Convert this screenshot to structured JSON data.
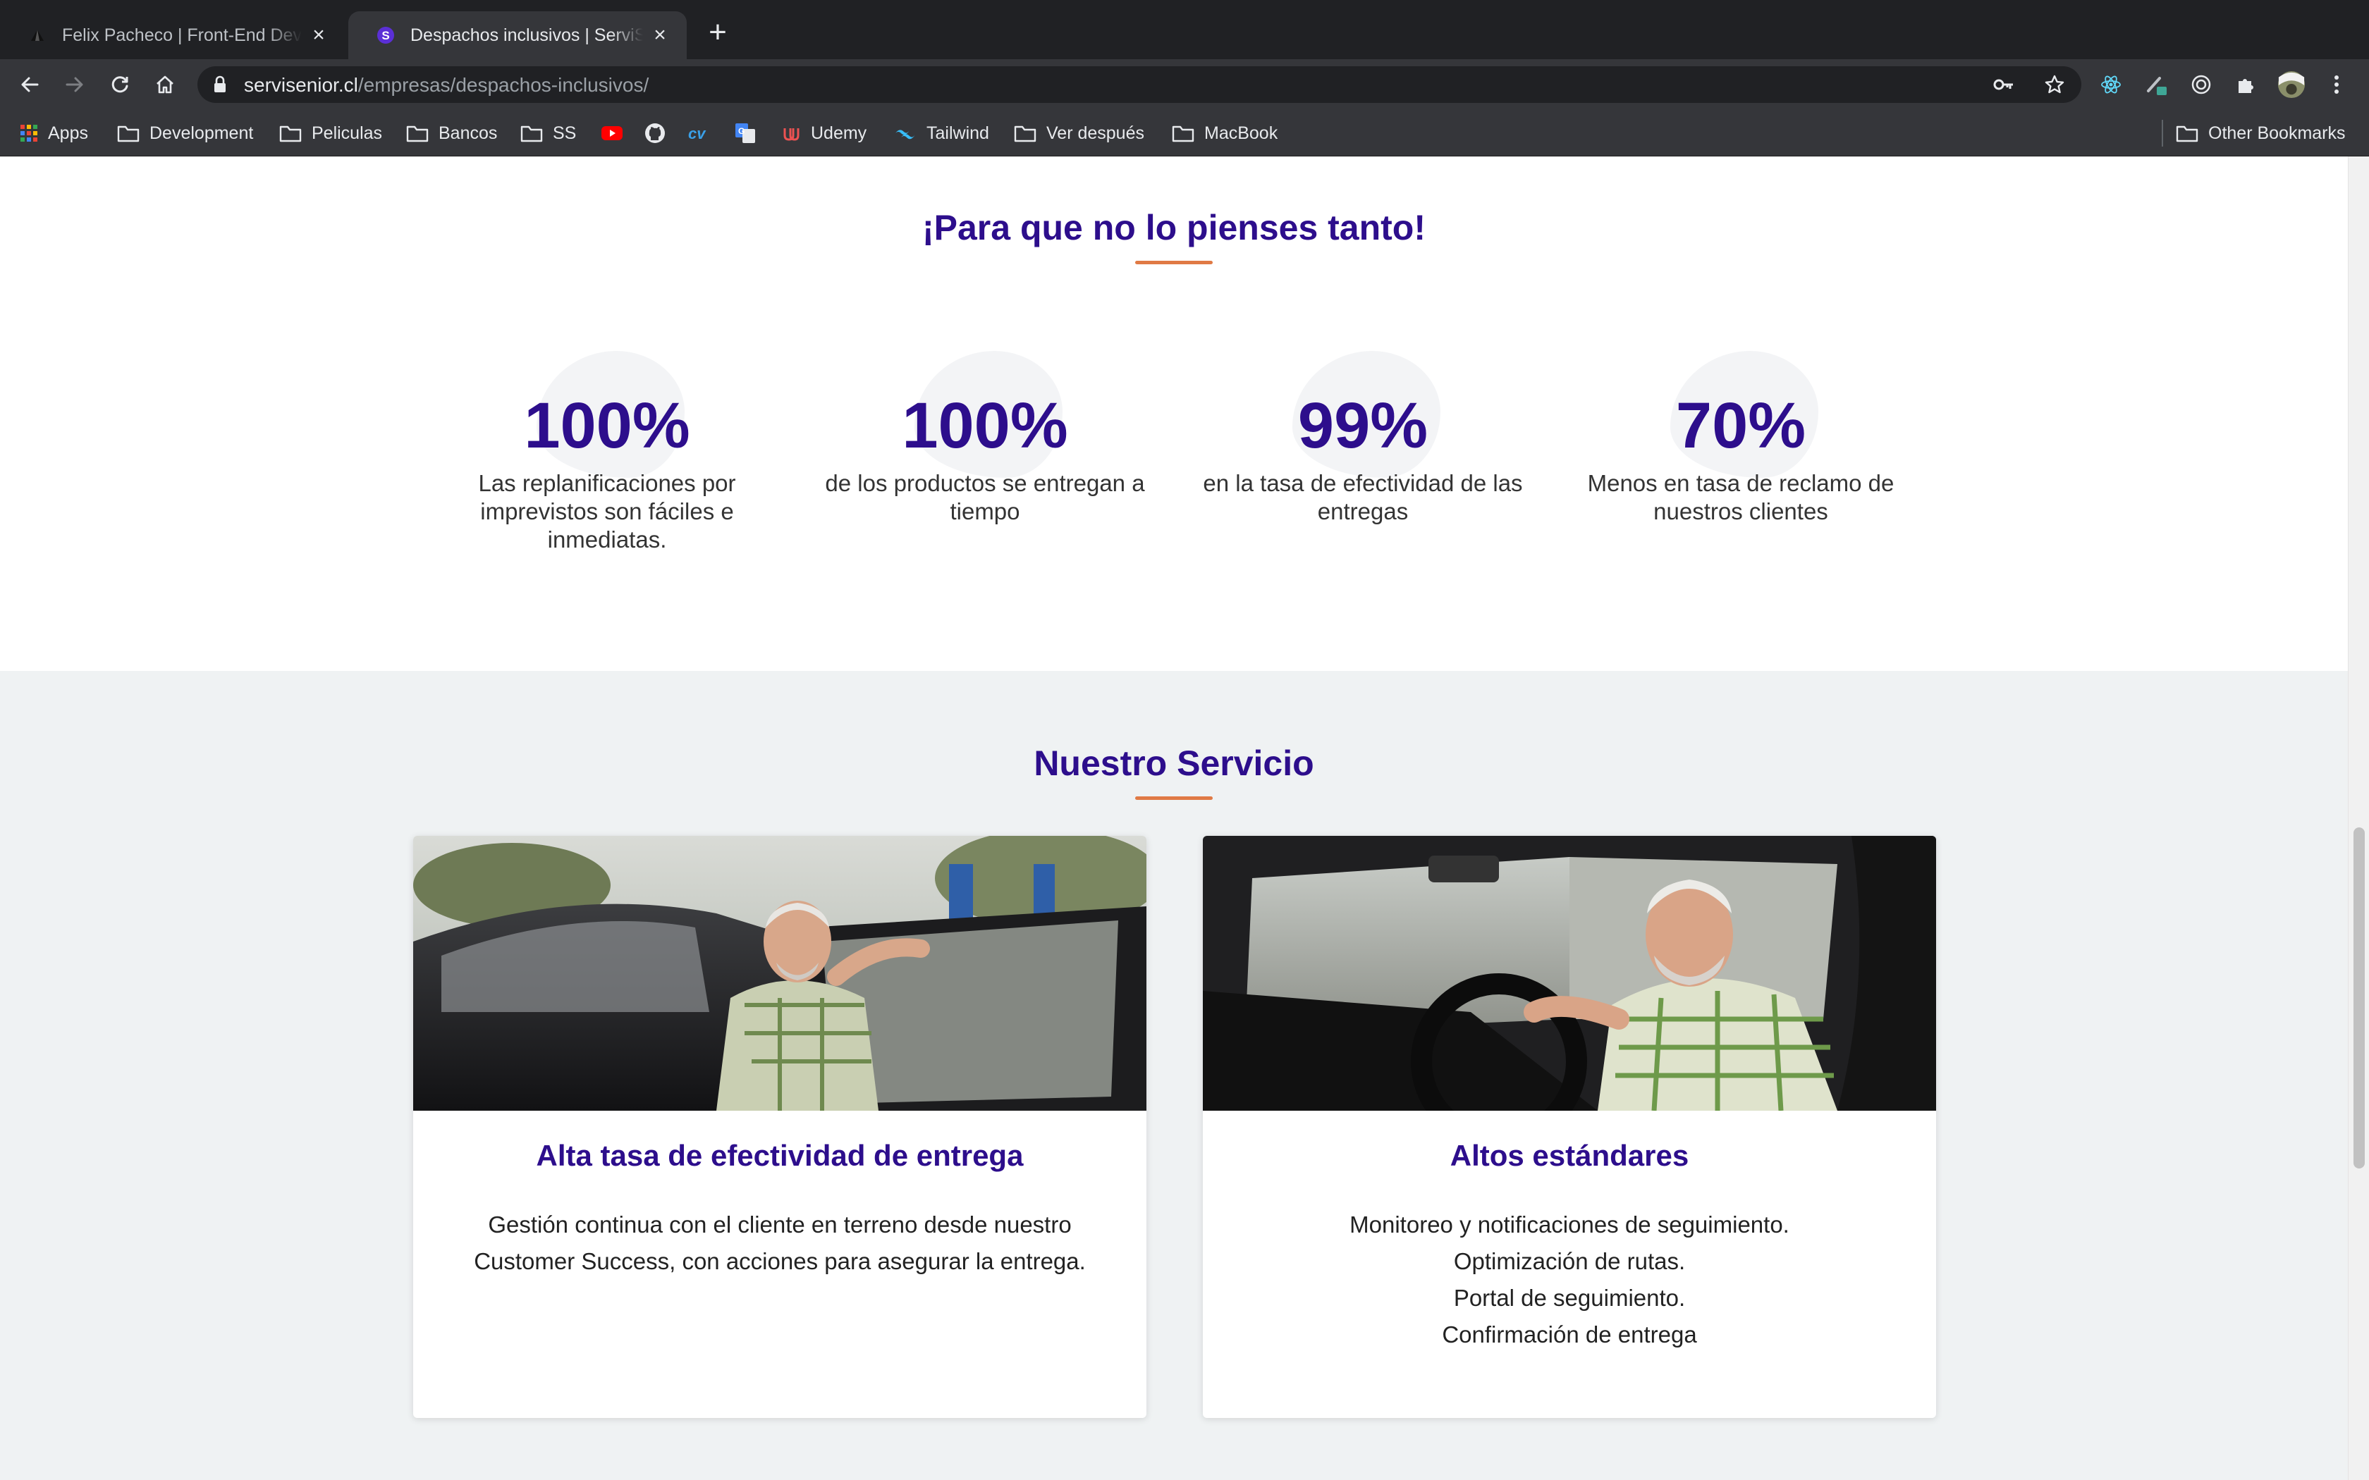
{
  "browser": {
    "tabs": [
      {
        "title": "Felix Pacheco | Front-End Developer",
        "active": false,
        "favicon": "triangle-logo-icon"
      },
      {
        "title": "Despachos inclusivos | ServiSenior",
        "active": true,
        "favicon": "servisenior-s-icon"
      }
    ],
    "url": {
      "host": "servisenior.cl",
      "path": "/empresas/despachos-inclusivos/"
    },
    "bookmarks": [
      {
        "label": "Apps",
        "icon": "apps-grid-icon"
      },
      {
        "label": "Development",
        "icon": "folder-icon"
      },
      {
        "label": "Peliculas",
        "icon": "folder-icon"
      },
      {
        "label": "Bancos",
        "icon": "folder-icon"
      },
      {
        "label": "SS",
        "icon": "folder-icon"
      },
      {
        "label": "",
        "icon": "youtube-icon"
      },
      {
        "label": "",
        "icon": "github-icon"
      },
      {
        "label": "",
        "icon": "cv-icon"
      },
      {
        "label": "",
        "icon": "translate-icon"
      },
      {
        "label": "Udemy",
        "icon": "udemy-icon"
      },
      {
        "label": "Tailwind",
        "icon": "tailwind-icon"
      },
      {
        "label": "Ver después",
        "icon": "folder-icon"
      },
      {
        "label": "MacBook",
        "icon": "folder-icon"
      }
    ],
    "other_bookmarks": "Other Bookmarks"
  },
  "stats_section": {
    "title": "¡Para que no lo pienses tanto!",
    "stats": [
      {
        "value": "100%",
        "desc_lines": [
          "Las replanificaciones por",
          "imprevistos son fáciles e",
          "inmediatas."
        ]
      },
      {
        "value": "100%",
        "desc_lines": [
          "de los productos se entregan a",
          "tiempo"
        ]
      },
      {
        "value": "99%",
        "desc_lines": [
          "en la tasa de efectividad de las",
          "entregas"
        ]
      },
      {
        "value": "70%",
        "desc_lines": [
          "Menos en tasa de reclamo de",
          "nuestros clientes"
        ]
      }
    ]
  },
  "service_section": {
    "title": "Nuestro Servicio",
    "cards": [
      {
        "title": "Alta tasa de efectividad de entrega",
        "image": "senior-man-standing-by-car-photo",
        "body_lines": [
          "Gestión continua con el cliente en terreno desde nuestro",
          "Customer Success, con acciones para asegurar la entrega."
        ]
      },
      {
        "title": "Altos estándares",
        "image": "senior-man-driving-car-photo",
        "body_lines": [
          "Monitoreo y notificaciones de seguimiento.",
          "Optimización de rutas.",
          "Portal de seguimiento.",
          "Confirmación de entrega"
        ]
      }
    ]
  },
  "colors": {
    "brand_purple": "#2d0e8c",
    "accent_orange": "#e07a45",
    "section_bg": "#eff2f3"
  }
}
